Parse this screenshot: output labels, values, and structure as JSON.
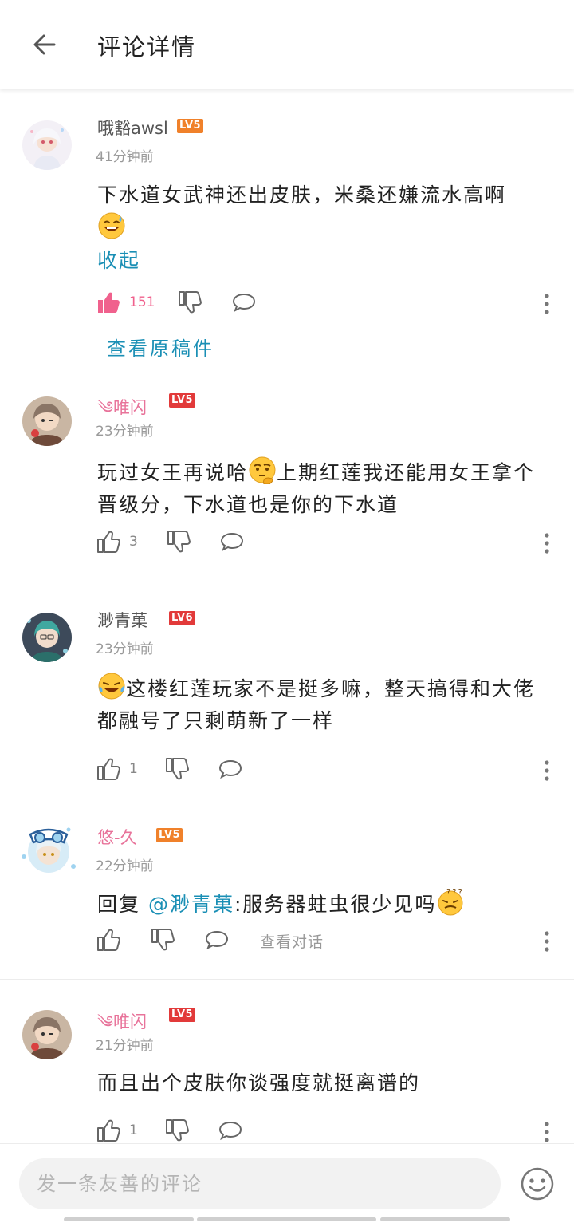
{
  "header": {
    "title": "评论详情",
    "back_icon": "arrow-left-icon"
  },
  "comments": [
    {
      "username": "哦豁awsl",
      "level": "LV5",
      "level_color": "#f0812a",
      "time": "41分钟前",
      "text": "下水道女武神还出皮肤，米桑还嫌流水高啊",
      "emoji": "sweat-smile-emoji",
      "collapse_label": "收起",
      "likes": "151",
      "liked": true,
      "view_original": "查看原稿件"
    },
    {
      "username": "༄唯闪",
      "level": "LV5",
      "level_color": "#e23a3a",
      "time": "23分钟前",
      "text_part1": "玩过女王再说哈",
      "emoji": "thinking-emoji",
      "text_part2": "上期红莲我还能用女王拿个晋级分，下水道也是你的下水道",
      "likes": "3"
    },
    {
      "username": "渺青菓",
      "level": "LV6",
      "level_color": "#e23a3a",
      "time": "23分钟前",
      "emoji": "crying-laugh-emoji",
      "text": "这楼红莲玩家不是挺多嘛，整天搞得和大佬都融号了只剩萌新了一样",
      "likes": "1"
    },
    {
      "username": "悠-久",
      "level": "LV5",
      "level_color": "#f0812a",
      "time": "22分钟前",
      "reply_prefix": "回复 ",
      "mention": "@渺青菓",
      "text": ":服务器蛀虫很少见吗",
      "emoji": "confused-emoji",
      "view_convo": "查看对话"
    },
    {
      "username": "༄唯闪",
      "level": "LV5",
      "level_color": "#e23a3a",
      "time": "21分钟前",
      "text": "而且出个皮肤你谈强度就挺离谱的",
      "likes": "1"
    }
  ],
  "bottom": {
    "placeholder": "发一条友善的评论",
    "emoji_icon": "smiley-face-icon"
  },
  "colors": {
    "link": "#1a8fb5",
    "like_active": "#f0618d",
    "username_pink": "#e8739a"
  }
}
